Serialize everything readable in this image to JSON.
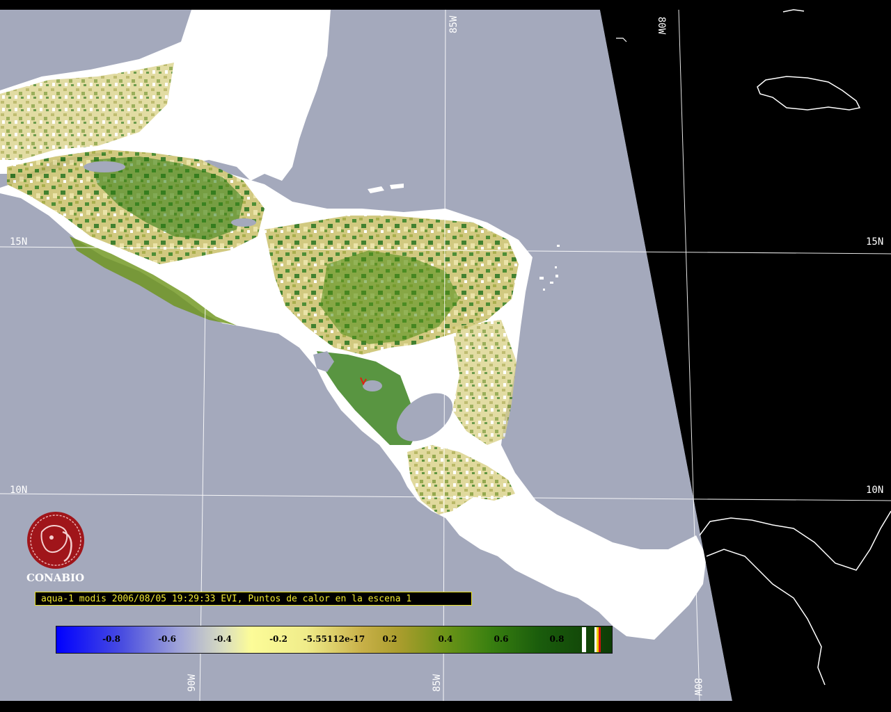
{
  "map": {
    "colors": {
      "ocean": "#a4a9bc",
      "outside": "#000000",
      "cloud": "#ffffff",
      "veg_low": "#d8cf7a",
      "veg_mid": "#8a9c28",
      "veg_high": "#1f6b0c",
      "water_neg": "#3b44c8",
      "grid": "#ffffff"
    },
    "grid_labels": {
      "lat_15_left": "15N",
      "lat_15_right": "15N",
      "lat_10_left": "10N",
      "lat_10_right": "10N",
      "lon_85_top": "85W",
      "lon_80_top": "80W",
      "lon_90_bottom": "90W",
      "lon_85_bottom": "85W",
      "lon_80_bottom": "80W"
    }
  },
  "logo": {
    "text": "CONABIO",
    "color": "#a0151a"
  },
  "caption": "aqua-1 modis 2006/08/05 19:29:33 EVI, Puntos de calor en la escena 1",
  "colorbar": {
    "ticks": [
      "-0.8",
      "-0.6",
      "-0.4",
      "-0.2",
      "-5.55112e-17",
      "0.2",
      "0.4",
      "0.6",
      "0.8"
    ],
    "tick_values": [
      -0.8,
      -0.6,
      -0.4,
      -0.2,
      -5.55112e-17,
      0.2,
      0.4,
      0.6,
      0.8
    ]
  }
}
